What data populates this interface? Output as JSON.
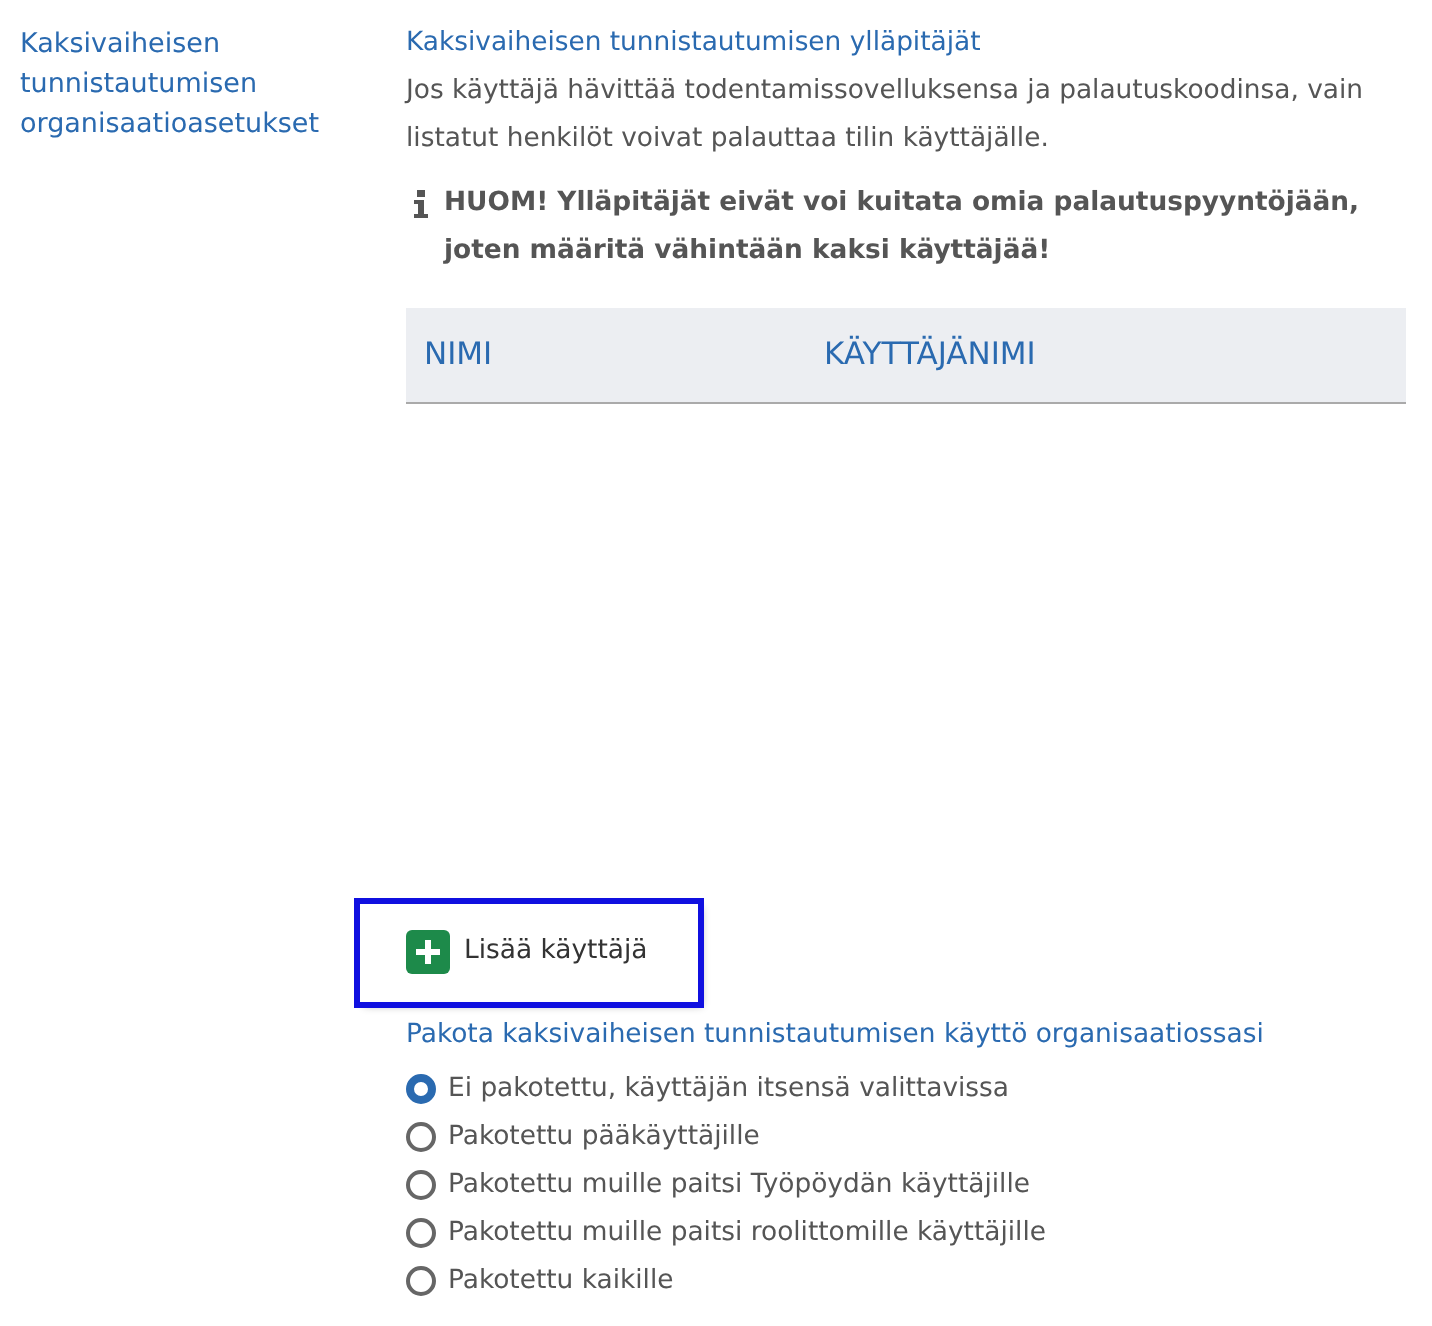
{
  "section_label": "Kaksivaiheisen tunnistautumisen organisaatioasetukset",
  "admins": {
    "title": "Kaksivaiheisen tunnistautumisen ylläpitäjät",
    "description": "Jos käyttäjä hävittää todentamissovelluksensa ja palautuskoodinsa, vain listatut henkilöt voivat palauttaa tilin käyttäjälle.",
    "notice": "HUOM! Ylläpitäjät eivät voi kuitata omia palautuspyyntöjään, joten määritä vähintään kaksi käyttäjää!",
    "table": {
      "columns": [
        "NIMI",
        "KÄYTTÄJÄNIMI"
      ]
    },
    "add_button": {
      "label": "Lisää käyttäjä",
      "highlighted": true
    }
  },
  "enforce": {
    "title": "Pakota kaksivaiheisen tunnistautumisen käyttö organisaatiossasi",
    "options": [
      {
        "label": "Ei pakotettu, käyttäjän itsensä valittavissa",
        "selected": true
      },
      {
        "label": "Pakotettu pääkäyttäjille",
        "selected": false
      },
      {
        "label": "Pakotettu muille paitsi Työpöydän käyttäjille",
        "selected": false
      },
      {
        "label": "Pakotettu muille paitsi roolittomille käyttäjille",
        "selected": false
      },
      {
        "label": "Pakotettu kaikille",
        "selected": false
      }
    ]
  }
}
